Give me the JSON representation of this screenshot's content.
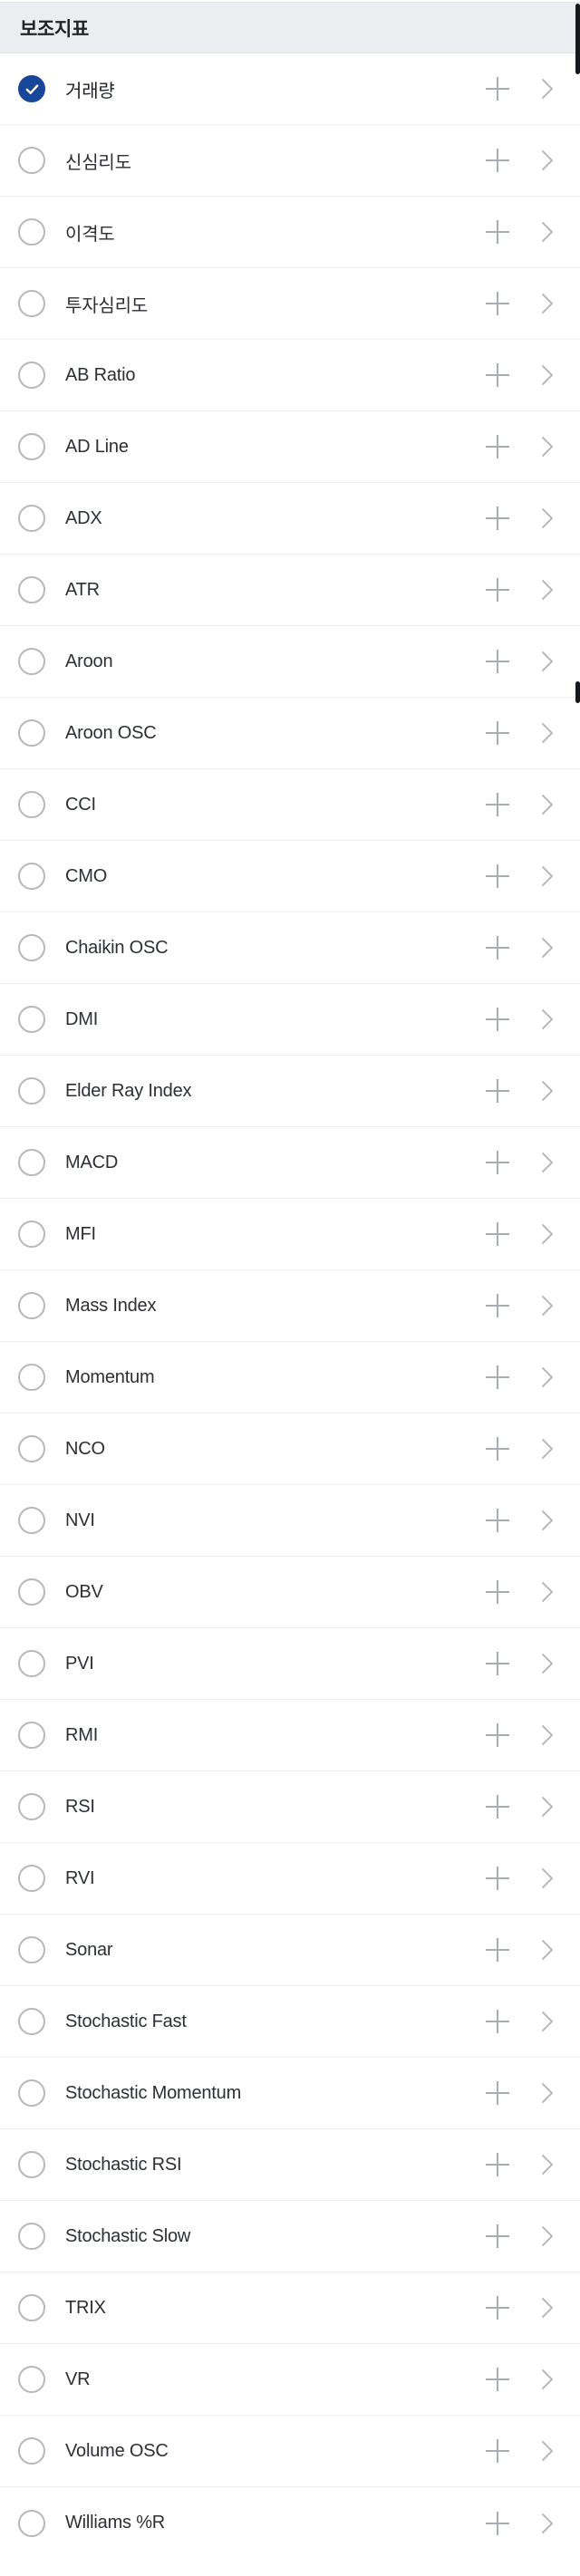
{
  "screen": {
    "name": "indicator-picker",
    "background": "#ffffff"
  },
  "section": {
    "title": "보조지표",
    "background": "#ecedf1",
    "text_color": "#222528"
  },
  "colors": {
    "selected_fill": "#18479a",
    "check_mark": "#ffffff",
    "radio_border": "#b4b7bc",
    "icon_gray": "#a9acb1",
    "divider": "#ededf0",
    "label": "#2c2f33",
    "scrollbar": "#15181c"
  },
  "row_icons": {
    "add": "plus-icon",
    "detail": "chevron-right-icon"
  },
  "items": [
    {
      "label": "거래량",
      "selected": true
    },
    {
      "label": "신심리도",
      "selected": false
    },
    {
      "label": "이격도",
      "selected": false
    },
    {
      "label": "투자심리도",
      "selected": false
    },
    {
      "label": "AB Ratio",
      "selected": false
    },
    {
      "label": "AD Line",
      "selected": false
    },
    {
      "label": "ADX",
      "selected": false
    },
    {
      "label": "ATR",
      "selected": false
    },
    {
      "label": "Aroon",
      "selected": false
    },
    {
      "label": "Aroon OSC",
      "selected": false
    },
    {
      "label": "CCI",
      "selected": false
    },
    {
      "label": "CMO",
      "selected": false
    },
    {
      "label": "Chaikin OSC",
      "selected": false
    },
    {
      "label": "DMI",
      "selected": false
    },
    {
      "label": "Elder Ray Index",
      "selected": false
    },
    {
      "label": "MACD",
      "selected": false
    },
    {
      "label": "MFI",
      "selected": false
    },
    {
      "label": "Mass Index",
      "selected": false
    },
    {
      "label": "Momentum",
      "selected": false
    },
    {
      "label": "NCO",
      "selected": false
    },
    {
      "label": "NVI",
      "selected": false
    },
    {
      "label": "OBV",
      "selected": false
    },
    {
      "label": "PVI",
      "selected": false
    },
    {
      "label": "RMI",
      "selected": false
    },
    {
      "label": "RSI",
      "selected": false
    },
    {
      "label": "RVI",
      "selected": false
    },
    {
      "label": "Sonar",
      "selected": false
    },
    {
      "label": "Stochastic Fast",
      "selected": false
    },
    {
      "label": "Stochastic Momentum",
      "selected": false
    },
    {
      "label": "Stochastic RSI",
      "selected": false
    },
    {
      "label": "Stochastic Slow",
      "selected": false
    },
    {
      "label": "TRIX",
      "selected": false
    },
    {
      "label": "VR",
      "selected": false
    },
    {
      "label": "Volume OSC",
      "selected": false
    },
    {
      "label": "Williams %R",
      "selected": false
    }
  ]
}
